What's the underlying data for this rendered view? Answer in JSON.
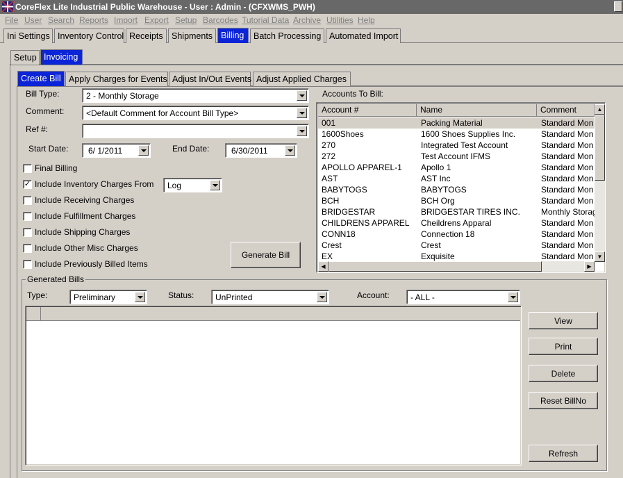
{
  "window": {
    "title": "CoreFlex Lite Industrial Public Warehouse - User : Admin - (CFXWMS_PWH)"
  },
  "menu": [
    "File",
    "User",
    "Search",
    "Reports",
    "Import",
    "Export",
    "Setup",
    "Barcodes",
    "Tutorial Data",
    "Archive",
    "Utilities",
    "Help"
  ],
  "main_tabs": [
    "Ini Settings",
    "Inventory Control",
    "Receipts",
    "Shipments",
    "Billing",
    "Batch Processing",
    "Automated Import"
  ],
  "sub_tabs": [
    "Setup",
    "Invoicing"
  ],
  "bill_tabs": [
    "Create Bill",
    "Apply Charges for Events",
    "Adjust In/Out Events",
    "Adjust Applied Charges"
  ],
  "form": {
    "bill_type_label": "Bill Type:",
    "bill_type_value": "2 - Monthly Storage",
    "comment_label": "Comment:",
    "comment_value": "<Default Comment for Account Bill Type>",
    "ref_label": "Ref #:",
    "ref_value": "",
    "start_date_label": "Start Date:",
    "start_date_value": "6/ 1/2011",
    "end_date_label": "End Date:",
    "end_date_value": "6/30/2011",
    "inventory_from_value": "Log"
  },
  "checkboxes": [
    {
      "label": "Final Billing",
      "checked": false
    },
    {
      "label": "Include Inventory Charges From",
      "checked": true
    },
    {
      "label": "Include Receiving Charges",
      "checked": false
    },
    {
      "label": "Include Fulfillment Charges",
      "checked": false
    },
    {
      "label": "Include Shipping Charges",
      "checked": false
    },
    {
      "label": "Include Other Misc Charges",
      "checked": false
    },
    {
      "label": "Include Previously Billed Items",
      "checked": false
    }
  ],
  "generate_bill_label": "Generate Bill",
  "accounts": {
    "title": "Accounts To Bill:",
    "columns": [
      "Account #",
      "Name",
      "Comment"
    ],
    "rows": [
      [
        "001",
        "Packing Material",
        "Standard Mon"
      ],
      [
        "1600Shoes",
        "1600 Shoes Supplies Inc.",
        "Standard Mon"
      ],
      [
        "270",
        "Integrated Test Account",
        "Standard Mon"
      ],
      [
        "272",
        "Test Account IFMS",
        "Standard Mon"
      ],
      [
        "APOLLO APPAREL-1",
        "Apollo 1",
        "Standard Mon"
      ],
      [
        "AST",
        "AST Inc",
        "Standard Mon"
      ],
      [
        "BABYTOGS",
        "BABYTOGS",
        "Standard Mon"
      ],
      [
        "BCH",
        "BCH Org",
        "Standard Mon"
      ],
      [
        "BRIDGESTAR",
        "BRIDGESTAR TIRES INC.",
        "Monthly Storag"
      ],
      [
        "CHILDRENS APPAREL",
        "Cheildrens Apparal",
        "Standard Mon"
      ],
      [
        "CONN18",
        "Connection 18",
        "Standard Mon"
      ],
      [
        "Crest",
        "Crest",
        "Standard Mon"
      ],
      [
        "EX",
        "Exquisite",
        "Standard Mon"
      ]
    ]
  },
  "generated_bills": {
    "title": "Generated Bills",
    "type_label": "Type:",
    "type_value": "Preliminary",
    "status_label": "Status:",
    "status_value": "UnPrinted",
    "account_label": "Account:",
    "account_value": "- ALL -",
    "buttons": [
      "View",
      "Print",
      "Delete",
      "Reset BillNo",
      "Refresh"
    ]
  },
  "colors": {
    "accent": "#0c24d8",
    "face": "#d4d0c8",
    "titlebar": "#686868"
  }
}
